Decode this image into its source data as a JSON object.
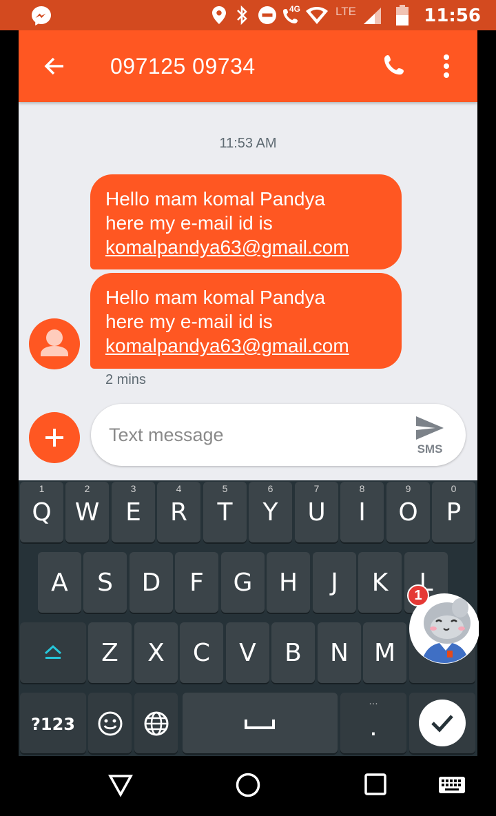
{
  "status_bar": {
    "time": "11:56",
    "network_4g": "4G",
    "network_lte": "LTE",
    "icons": [
      "messenger-icon",
      "location-icon",
      "bluetooth-icon",
      "do-not-disturb-icon",
      "wifi-calling-icon",
      "wifi-icon",
      "signal-icon",
      "battery-icon"
    ]
  },
  "app_bar": {
    "title": "097125 09734",
    "back_icon": "arrow-back-icon",
    "call_icon": "phone-icon",
    "menu_icon": "more-vert-icon"
  },
  "conversation": {
    "timestamp": "11:53 AM",
    "messages": [
      {
        "line1": "Hello mam komal Pandya",
        "line2": "here my e-mail id is",
        "email": "komalpandya63@gmail.com"
      },
      {
        "line1": "Hello mam komal Pandya",
        "line2": "here my e-mail id is",
        "email": "komalpandya63@gmail.com"
      }
    ],
    "meta": "2 mins"
  },
  "compose": {
    "placeholder": "Text message",
    "value": "",
    "send_label": "SMS"
  },
  "keyboard": {
    "row1": [
      {
        "key": "Q",
        "hint": "1"
      },
      {
        "key": "W",
        "hint": "2"
      },
      {
        "key": "E",
        "hint": "3"
      },
      {
        "key": "R",
        "hint": "4"
      },
      {
        "key": "T",
        "hint": "5"
      },
      {
        "key": "Y",
        "hint": "6"
      },
      {
        "key": "U",
        "hint": "7"
      },
      {
        "key": "I",
        "hint": "8"
      },
      {
        "key": "O",
        "hint": "9"
      },
      {
        "key": "P",
        "hint": "0"
      }
    ],
    "row2": [
      "A",
      "S",
      "D",
      "F",
      "G",
      "H",
      "J",
      "K",
      "L"
    ],
    "row3": [
      "Z",
      "X",
      "C",
      "V",
      "B",
      "N",
      "M"
    ],
    "symbols_label": "?123",
    "period_label": ".",
    "period_hint": "…"
  },
  "chat_head": {
    "badge": "1"
  },
  "colors": {
    "accent": "#ff5722",
    "status_bar": "#d34a1f",
    "background": "#ecedf1",
    "keyboard": "#263238",
    "key": "#3b4449",
    "shift_accent": "#26c6da"
  }
}
